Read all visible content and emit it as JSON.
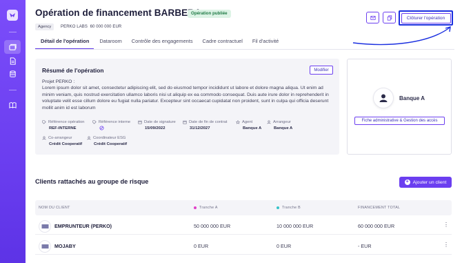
{
  "header": {
    "title": "Opération de financement BARBERA",
    "status": "Opération publiée",
    "agency": "Agency",
    "company": "PERKO LABS",
    "amount": "60 000 000 EUR",
    "close_label": "Clôturer l'opération"
  },
  "tabs": [
    "Détail de l'opération",
    "Dataroom",
    "Contrôle des engagements",
    "Cadre contractuel",
    "Fil d'activité"
  ],
  "summary": {
    "title": "Résumé de l'opération",
    "modify_label": "Modifier",
    "project": "Projet PERKO :",
    "text": "Lorem ipsum dolor sit amet, consectetur adipiscing elit, sed do eiusmod tempor incididunt ut labore et dolore magna aliqua. Ut enim ad minim veniam, quis nostrud exercitation ullamco laboris nisi ut aliquip ex ea commodo consequat. Duis aute irure dolor in reprehenderit in voluptate velit esse cillum dolore eu fugiat nulla pariatur. Excepteur sint occaecat cupidatat non proident, sunt in culpa qui officia deserunt mollit anim id est laborum",
    "meta": [
      {
        "label": "Référence opération",
        "value": "REF-INTERNE"
      },
      {
        "label": "Référence interne",
        "value": ""
      },
      {
        "label": "Date de signature",
        "value": "15/09/2022"
      },
      {
        "label": "Date de fin de contrat",
        "value": "31/12/2027"
      },
      {
        "label": "Agent",
        "value": "Banque A"
      },
      {
        "label": "Arrangeur",
        "value": "Banque A"
      },
      {
        "label": "Co-arrangeur",
        "value": "Crédit Cooperatif"
      },
      {
        "label": "Coordinateur ESG",
        "value": "Crédit Cooperatif"
      }
    ]
  },
  "bank": {
    "name": "Banque A",
    "button_label": "Fiche administrative & Gestion des accès"
  },
  "clients": {
    "title": "Clients rattachés au groupe de risque",
    "add_label": "Ajouter un client",
    "columns": [
      "NOM DU CLIENT",
      "Tranche A",
      "Tranche B",
      "FINANCEMENT TOTAL"
    ],
    "colors": {
      "tranche_a": "#e040c8",
      "tranche_b": "#36c3c8"
    },
    "rows": [
      {
        "name": "EMPRUNTEUR (PERKO)",
        "a": "50 000 000 EUR",
        "b": "10 000 000 EUR",
        "total": "60 000 000 EUR"
      },
      {
        "name": "MOJABY",
        "a": "0 EUR",
        "b": "0 EUR",
        "total": "- EUR"
      }
    ]
  }
}
